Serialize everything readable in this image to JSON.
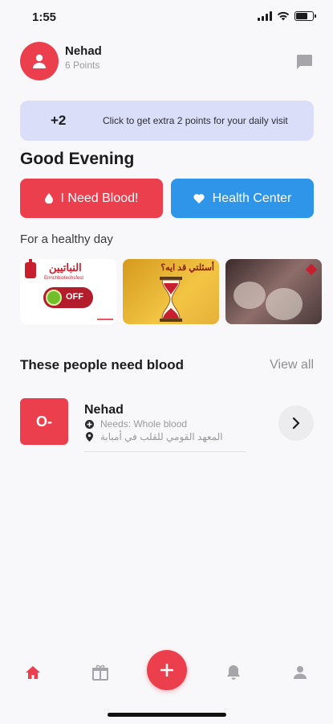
{
  "status_bar": {
    "time": "1:55"
  },
  "profile": {
    "name": "Nehad",
    "points": "6 Points"
  },
  "daily_banner": {
    "badge": "+2",
    "text": "Click to get extra 2 points for your daily visit"
  },
  "greeting": "Good Evening",
  "actions": {
    "need_blood": "I Need Blood!",
    "health_center": "Health Center"
  },
  "healthy_day": {
    "title": "For a healthy day",
    "cards": [
      {
        "heading": "النباتيين",
        "subtitle": "Enrichbiotechsfest",
        "toggle": "OFF"
      },
      {
        "heading": "أسئلتي قد ايه؟"
      },
      {}
    ]
  },
  "people_need": {
    "title": "These people need blood",
    "view_all": "View all",
    "requests": [
      {
        "blood_type": "O-",
        "name": "Nehad",
        "needs": "Needs: Whole blood",
        "location": "المعهد القومي للقلب في أمبابة"
      }
    ]
  },
  "colors": {
    "primary": "#ec3f4e",
    "secondary": "#2f95e8",
    "banner": "#dbdef9"
  },
  "tabs": [
    "home-icon",
    "gift-icon",
    "add-icon",
    "bell-icon",
    "profile-icon"
  ]
}
